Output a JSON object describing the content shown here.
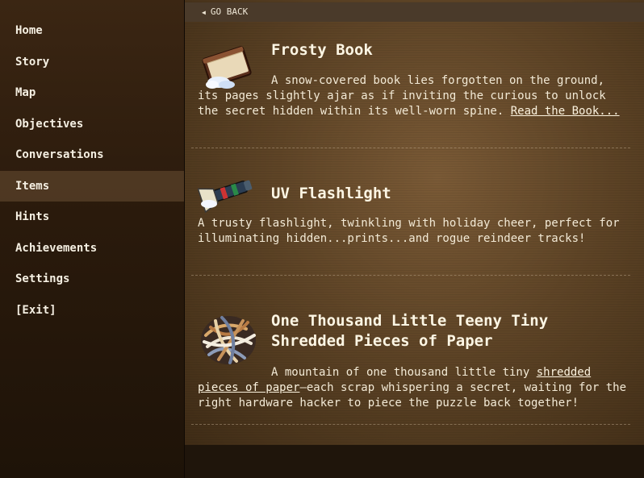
{
  "sidebar": {
    "items": [
      {
        "label": "Home"
      },
      {
        "label": "Story"
      },
      {
        "label": "Map"
      },
      {
        "label": "Objectives"
      },
      {
        "label": "Conversations"
      },
      {
        "label": "Items"
      },
      {
        "label": "Hints"
      },
      {
        "label": "Achievements"
      },
      {
        "label": "Settings"
      },
      {
        "label": "[Exit]"
      }
    ],
    "active": "Items"
  },
  "header": {
    "go_back": "GO BACK"
  },
  "items": [
    {
      "title": "Frosty Book",
      "desc": "A snow-covered book lies forgotten on the ground, its pages slightly ajar as if inviting the curious to unlock the secret hidden within its well-worn spine.",
      "link": "Read the Book...",
      "icon": "snowy-book-icon"
    },
    {
      "title": "UV Flashlight",
      "desc": "A trusty flashlight, twinkling with holiday cheer, perfect for illuminating hidden...prints...and rogue reindeer tracks!",
      "icon": "flashlight-icon"
    },
    {
      "title_line1": "One Thousand Little Teeny Tiny",
      "title_line2": "Shredded Pieces of Paper",
      "desc_pre": "A mountain of one thousand little tiny",
      "link": "shredded pieces of paper",
      "desc_post": "—each scrap whispering a secret, waiting for the right hardware hacker to piece the puzzle back together!",
      "icon": "shredded-paper-icon"
    }
  ]
}
